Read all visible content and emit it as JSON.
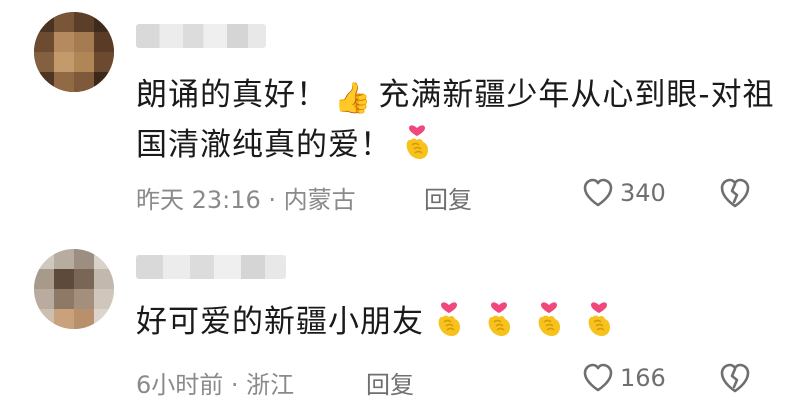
{
  "comments": [
    {
      "text_1": "朗诵的真好！",
      "thumb_emoji": "👍",
      "text_2": "充满新疆少年从心到眼-对祖国清澈纯真的爱！",
      "heart_hand_emojis": 1,
      "meta_time": "昨天 23:16 · 内蒙古",
      "reply_label": "回复",
      "like_count": "340"
    },
    {
      "text_1": "好可爱的新疆小朋友",
      "heart_hand_emojis": 4,
      "meta_time": "6小时前 · 浙江",
      "reply_label": "回复",
      "like_count": "166"
    }
  ],
  "icons": {
    "like": "heart-outline-icon",
    "dislike": "broken-heart-icon",
    "emoji": "heart-hands-emoji"
  },
  "colors": {
    "text": "#1a1a1a",
    "meta": "#8a8a8a",
    "icon": "#6f6f6f",
    "heart_hand_heart": "#f0477c",
    "heart_hand_skin": "#f7c21b"
  }
}
